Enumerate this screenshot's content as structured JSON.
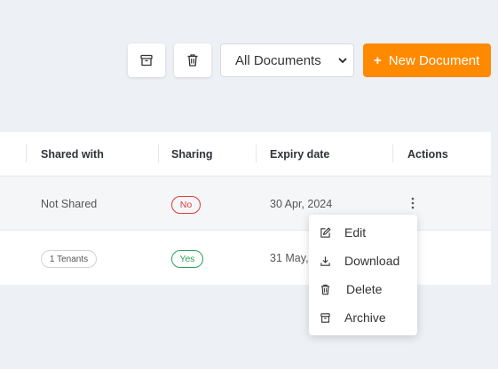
{
  "toolbar": {
    "archive_icon": "archive-box-icon",
    "trash_icon": "trash-icon",
    "filter_value": "All Documents",
    "new_document_plus": "+",
    "new_document_label": "New Document",
    "accent_color": "#ff8a00"
  },
  "table": {
    "headers": [
      "Shared with",
      "Sharing",
      "Expiry date",
      "Actions"
    ],
    "rows": [
      {
        "shared_with": "Not Shared",
        "sharing": "No",
        "expiry": "30 Apr, 2024"
      },
      {
        "shared_with": "1 Tenants",
        "sharing": "Yes",
        "expiry": "31 May,"
      }
    ]
  },
  "menu": {
    "items": [
      {
        "label": "Edit",
        "icon": "edit-icon"
      },
      {
        "label": "Download",
        "icon": "download-icon"
      },
      {
        "label": "Delete",
        "icon": "trash-icon"
      },
      {
        "label": "Archive",
        "icon": "archive-icon"
      }
    ]
  }
}
